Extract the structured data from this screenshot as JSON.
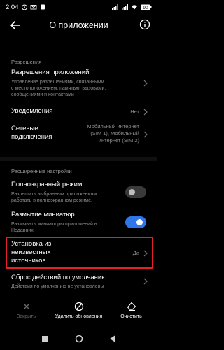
{
  "status_bar": {
    "time": "2:04",
    "battery": "90"
  },
  "app_bar": {
    "title": "О приложении"
  },
  "sections": {
    "permissions_header": "Разрешения",
    "advanced_header": "Расширенные настройки"
  },
  "rows": {
    "app_permissions": {
      "title": "Разрешения приложений",
      "subtitle": [
        "Управление разрешениями, связанными",
        "с местоположением, памятью, вызовами,",
        "сообщениями и контактами"
      ]
    },
    "notifications": {
      "title": "Уведомления",
      "value": "Нет"
    },
    "network": {
      "title": [
        "Сетевые",
        "подключения"
      ],
      "value": [
        "Мобильный интернет",
        "(SIM 1), Мобильный",
        "интернет (SIM 2)"
      ]
    },
    "fullscreen": {
      "title": "Полноэкранный режим",
      "subtitle": [
        "Разрешить выбранным приложениям",
        "работать в полноэкранном режиме."
      ],
      "enabled": false
    },
    "blur": {
      "title": "Размытие миниатюр",
      "subtitle": [
        "Размывать миниатюры приложений в",
        "Недавних."
      ],
      "enabled": true
    },
    "unknown_sources": {
      "title": [
        "Установка из",
        "неизвестных",
        "источников"
      ],
      "value": "Да"
    },
    "defaults": {
      "title": "Сброс действий по умолчанию",
      "subtitle": "Действия по умолчанию не установлены"
    }
  },
  "bottom_bar": {
    "close": "Закрыть",
    "uninstall_updates": "Удалить обновления",
    "clear": "Очистить"
  },
  "colors": {
    "accent": "#2f77e8",
    "highlight": "#e4202b",
    "background": "#000000"
  }
}
